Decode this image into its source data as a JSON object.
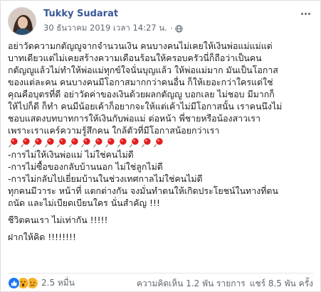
{
  "post": {
    "author": "Tukky Sudarat",
    "timestamp": "30 ธันวาคม 2019 เวลา 14:27 น.",
    "separator": "·",
    "privacy_icon": "globe-icon",
    "lines": [
      "อย่าวัดความกตัญญูจากจำนวนเงิน คนบางคนไม่เคยให้เงินพ่อแม่แม่แต่",
      "บาทเดียวแต่ไม่เคยสร้างความเดือนร้อนให้ครอบครัวนี่ก็ถือว่าเป็นคน",
      "กตัญญูแล้วไม่ทำให้พ่อแม่ทุกข์ใจนั่นบุญแล้ว ให้พ่อแม่มาก มันเป็นโอกาส",
      "ของแต่ละคน คนบางคนมีโอกาสมากกว่าคนอื่น ก็ให้เยอะกว่าใครแต่ใช่",
      "คุณคือบุตรที่ดี อย่าวัดค่าของเงินด้วยผลกตัญญู บอกเลย ไม่ชอบ มีมากก็",
      "ให้ไปก็ดี ก็ทำ คนมีน้อยเค้าก็อยากจะให้แต่เค้าไม่มีโอกาสนั้น เราคนนึงไม่",
      "ชอบแสดงบทบาทการให้เงินกับพ่อแม่ ต่อหน้า พี่ชายหรือน้องสาวเรา",
      "เพราะเราแคร์ความรู้สึกคน ใกล้ตัวที่มีโอกาสน้อยกว่าเรา"
    ],
    "pin_count": 13,
    "points": [
      "-การไม่ให้เงินพ่อแม่ ไม่ใช่คนไม่ดี",
      "-การไม่ซื้อของกลับบ้านนอก ไม่ใช่ลูกไม่ดี",
      "-การไม่กลับไปเยี่ยมบ้านในช่วงเทศกาลไม่ใช่คนไม่ดี",
      "ทุกคนมีวาระ หน้าที่ แตกต่างกัน จงมั่นทำตนให้เกิดประโยชน์ในทางที่ตน",
      "ถนัด และไม่เบียดเบียนใคร นั่นสำคัญ !!!"
    ],
    "closing_1": "ชีวิตคนเรา ไม่เท่ากัน !!!!!",
    "closing_2": "ฝากให้คิด !!!!!!!!"
  },
  "footer": {
    "reaction_count": "2.5 หมื่น",
    "reaction_icons": [
      "like-icon",
      "wow-icon",
      "sad-icon"
    ],
    "comments": "ความคิดเห็น 1.2 พัน รายการ",
    "shares": "แชร์ 8.5 พัน ครั้ง"
  },
  "colors": {
    "author": "#385898",
    "like": "#1877f2",
    "emoji": "#f7b125",
    "pin": "#e02020"
  }
}
